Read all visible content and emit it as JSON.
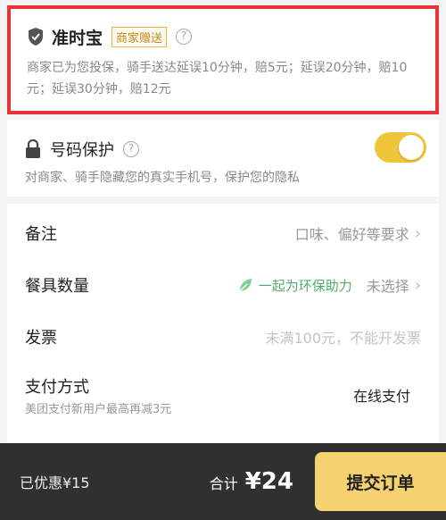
{
  "ontime": {
    "title": "准时宝",
    "badge": "商家赠送",
    "help": "?",
    "description": "商家已为您投保，骑手送达延误10分钟，赔5元；延误20分钟，赔10元；延误30分钟，赔12元"
  },
  "protection": {
    "title": "号码保护",
    "help": "?",
    "description": "对商家、骑手隐藏您的真实手机号，保护您的隐私",
    "enabled": true
  },
  "options": {
    "remark": {
      "label": "备注",
      "value": "口味、偏好等要求"
    },
    "tableware": {
      "label": "餐具数量",
      "eco": "一起为环保助力",
      "value": "未选择"
    },
    "invoice": {
      "label": "发票",
      "value": "未满100元，不能开发票"
    },
    "payment": {
      "label": "支付方式",
      "sub": "美团支付新用户最高再减3元",
      "value": "在线支付"
    }
  },
  "footer": {
    "saved": "已优惠¥15",
    "total_label": "合计",
    "total_amount": "¥24",
    "submit": "提交订单"
  },
  "colors": {
    "highlight": "#e8333b",
    "accent": "#f0c53a",
    "eco_green": "#4fae6e"
  }
}
